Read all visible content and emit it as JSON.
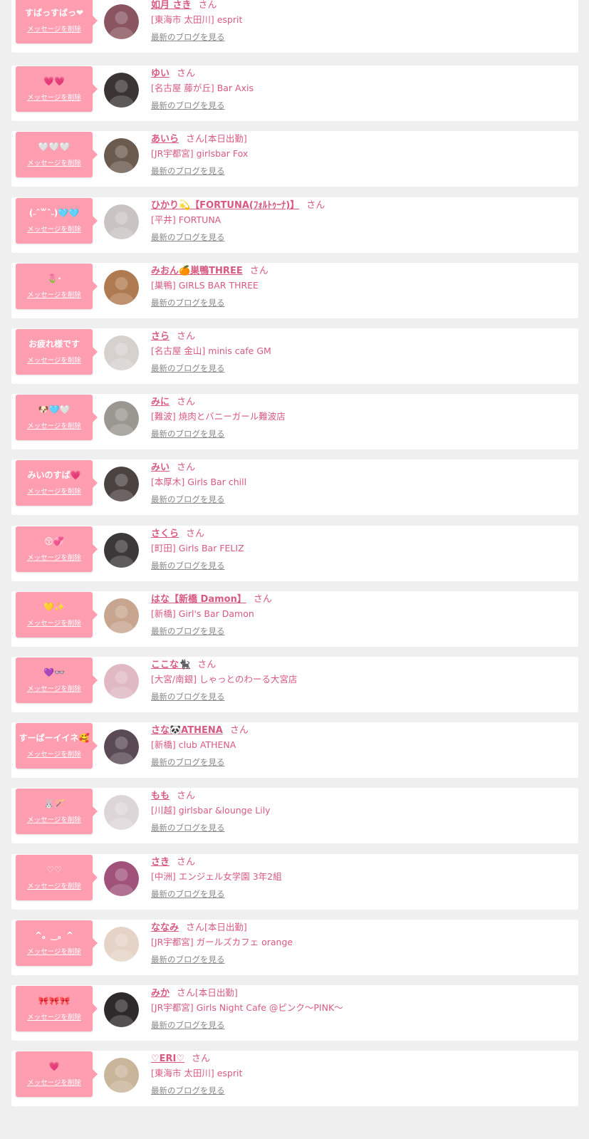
{
  "honorific": "さん",
  "delete_label": "メッセージを削除",
  "blog_label": "最新のブログを見る",
  "colors": {
    "page_bg": "#efefef",
    "bubble_pink": "#ff9eb1",
    "name_pink": "#d75a80",
    "link_gray": "#888888"
  },
  "messages": [
    {
      "stamp": "すばっすばっ❤",
      "name": "如月 さき",
      "shift": "",
      "shop": "[東海市 太田川] esprit",
      "avatar_color": "#8a5560"
    },
    {
      "stamp": "💗💗",
      "name": "ゆい",
      "shift": "",
      "shop": "[名古屋 藤が丘] Bar Axis",
      "avatar_color": "#3a3533"
    },
    {
      "stamp": "🤍🤍🤍",
      "name": "あいら",
      "shift": "[本日出勤]",
      "shop": "[JR宇都宮] girlsbar Fox",
      "avatar_color": "#6b5a4e"
    },
    {
      "stamp": "(˶ˆ꒳ˆ˵)🩵🩵",
      "name": "ひかり💫【FORTUNA(ﾌｫﾙﾄｩｰﾅ)】",
      "shift": "",
      "shop": "[平井] FORTUNA",
      "avatar_color": "#c9c4c2"
    },
    {
      "stamp": "🌷·",
      "name": "みおん🍊巣鴨THREE",
      "shift": "",
      "shop": "[巣鴨] GIRLS BAR THREE",
      "avatar_color": "#b07a50"
    },
    {
      "stamp": "お疲れ様です",
      "name": "さら",
      "shift": "",
      "shop": "[名古屋 金山] minis cafe GM",
      "avatar_color": "#d6d1cd"
    },
    {
      "stamp": "🐶🩵🤍",
      "name": "みに",
      "shift": "",
      "shop": "[難波] 焼肉とバニーガール難波店",
      "avatar_color": "#9a9690"
    },
    {
      "stamp": "みいのすば💗",
      "name": "みい",
      "shift": "",
      "shop": "[本厚木] Girls Bar chill",
      "avatar_color": "#4b4340"
    },
    {
      "stamp": "😚💞",
      "name": "さくら",
      "shift": "",
      "shop": "[町田] Girls Bar FELIZ",
      "avatar_color": "#3a3838"
    },
    {
      "stamp": "💛✨",
      "name": "はな【新橋 Damon】",
      "shift": "",
      "shop": "[新橋] Girl's Bar Damon",
      "avatar_color": "#c7a58e"
    },
    {
      "stamp": "💜👓",
      "name": "ここな🐈‍⬛",
      "shift": "",
      "shop": "[大宮/南銀] しゃっとのわーる大宮店",
      "avatar_color": "#e0b9c3"
    },
    {
      "stamp": "すーぱーイイネ🥰",
      "name": "さな🐼ATHENA",
      "shift": "",
      "shop": "[新橋] club ATHENA",
      "avatar_color": "#5a4a55"
    },
    {
      "stamp": "🐰🪄",
      "name": "もも",
      "shift": "",
      "shop": "[川越] girlsbar &lounge Lily",
      "avatar_color": "#ddd6d8"
    },
    {
      "stamp": "♡♡",
      "name": "さき",
      "shift": "",
      "shop": "[中洲] エンジェル女学園 3年2組",
      "avatar_color": "#a0527a"
    },
    {
      "stamp": "^。‿。^",
      "name": "ななみ",
      "shift": "[本日出勤]",
      "shop": "[JR宇都宮] ガールズカフェ orange",
      "avatar_color": "#e6d3c7"
    },
    {
      "stamp": "🎀🎀🎀",
      "name": "みか",
      "shift": "[本日出勤]",
      "shop": "[JR宇都宮] Girls Night Cafe @ピンク〜PINK〜",
      "avatar_color": "#2e2a2b"
    },
    {
      "stamp": "💗",
      "name": "♡ERI♡",
      "shift": "",
      "shop": "[東海市 太田川] esprit",
      "avatar_color": "#c9b59a"
    }
  ]
}
